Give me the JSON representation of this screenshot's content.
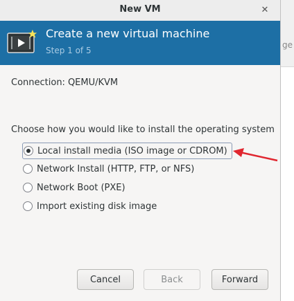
{
  "window": {
    "title": "New VM",
    "close_glyph": "✕"
  },
  "header": {
    "title": "Create a new virtual machine",
    "step": "Step 1 of 5",
    "icon": "new-vm-monitor-icon"
  },
  "connection": {
    "label": "Connection:",
    "value": "QEMU/KVM"
  },
  "install": {
    "prompt": "Choose how you would like to install the operating system",
    "selected_index": 0,
    "options": [
      "Local install media (ISO image or CDROM)",
      "Network Install (HTTP, FTP, or NFS)",
      "Network Boot (PXE)",
      "Import existing disk image"
    ]
  },
  "buttons": {
    "cancel": "Cancel",
    "back": "Back",
    "forward": "Forward"
  },
  "background_window": {
    "partial_text": "ge"
  },
  "colors": {
    "header_bg": "#1d6fa5",
    "annotation_arrow": "#e0262f"
  }
}
